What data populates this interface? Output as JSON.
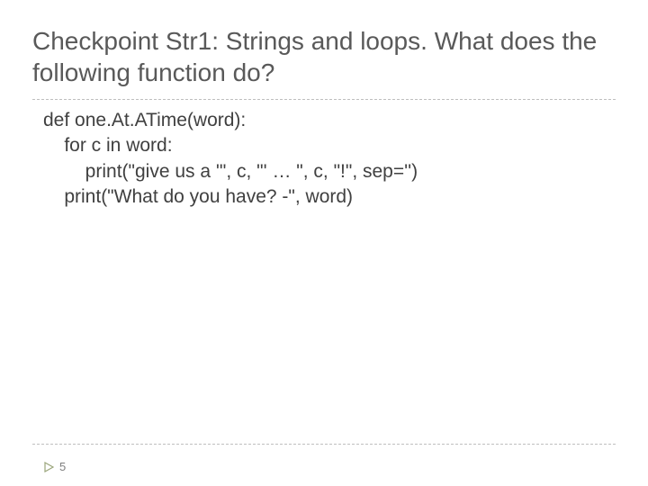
{
  "title": "Checkpoint Str1: Strings and loops.  What does the following function do?",
  "code": "def one.At.ATime(word):\n    for c in word:\n        print(\"give us a '\", c, \"' … \", c, \"!\", sep='')\n    print(\"What do you have? -\", word)",
  "page_number": "5"
}
